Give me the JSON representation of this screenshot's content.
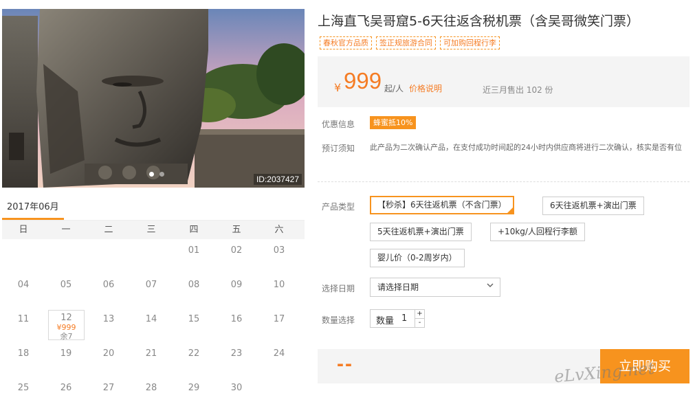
{
  "product": {
    "title": "上海直飞吴哥窟5-6天往返含税机票（含吴哥微笑门票）",
    "tags": [
      "春秋官方品质",
      "签正规旅游合同",
      "可加购回程行李"
    ],
    "image_id": "ID:2037427"
  },
  "price": {
    "currency": "¥",
    "amount": "999",
    "unit": "起/人",
    "explain_link": "价格说明",
    "sold": "近三月售出 102 份"
  },
  "promo": {
    "label": "优惠信息",
    "badge": "蜂蜜抵10%"
  },
  "notice": {
    "label": "预订须知",
    "text": "此产品为二次确认产品，在支付成功时间起的24小时内供应商将进行二次确认，核实是否有位"
  },
  "product_type": {
    "label": "产品类型",
    "options": [
      "【秒杀】6天往返机票（不含门票）",
      "6天往返机票+演出门票",
      "5天往返机票+演出门票",
      "+10kg/人回程行李额",
      "婴儿价（0-2周岁内）"
    ],
    "selected_index": 0
  },
  "date_select": {
    "label": "选择日期",
    "value": "请选择日期"
  },
  "quantity": {
    "label": "数量选择",
    "field_label": "数量",
    "value": "1",
    "plus": "+",
    "minus": "-"
  },
  "buy": {
    "total": "--",
    "button": "立即购买"
  },
  "calendar": {
    "month": "2017年06月",
    "weekdays": [
      "日",
      "一",
      "二",
      "三",
      "四",
      "五",
      "六"
    ],
    "weeks": [
      [
        "",
        "",
        "",
        "",
        "01",
        "02",
        "03"
      ],
      [
        "04",
        "05",
        "06",
        "07",
        "08",
        "09",
        "10"
      ],
      [
        "11",
        "12",
        "13",
        "14",
        "15",
        "16",
        "17"
      ],
      [
        "18",
        "19",
        "20",
        "21",
        "22",
        "23",
        "24"
      ],
      [
        "25",
        "26",
        "27",
        "28",
        "29",
        "30",
        ""
      ]
    ],
    "available": {
      "day": "12",
      "price": "¥999",
      "stock": "余7"
    }
  },
  "watermark": "eLvXing.net",
  "colors": {
    "accent": "#f7931e",
    "price": "#f57c24",
    "panel": "#f4f4f4"
  },
  "icons": {
    "chevron": "chevron-down-icon"
  }
}
